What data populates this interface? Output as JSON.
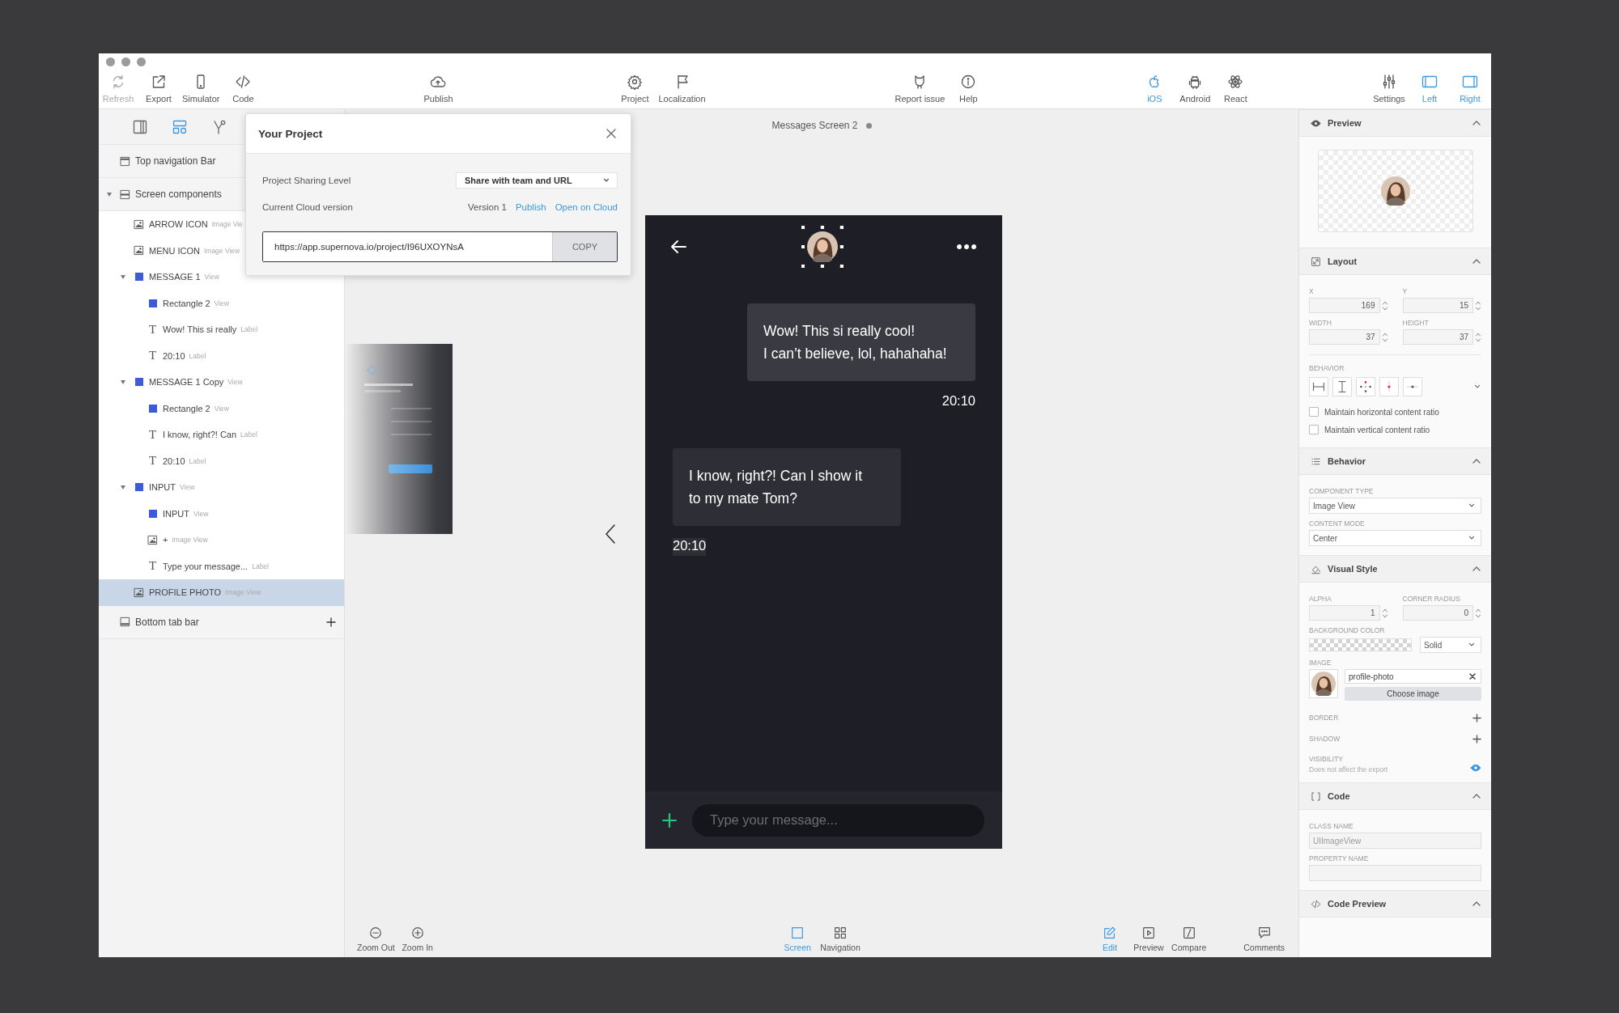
{
  "toolbar": {
    "groups": [
      [
        {
          "label": "Refresh",
          "disabled": true,
          "active": false
        },
        {
          "label": "Export",
          "disabled": false,
          "active": false
        },
        {
          "label": "Simulator",
          "disabled": false,
          "active": false
        },
        {
          "label": "Code",
          "disabled": false,
          "active": false
        }
      ],
      [
        {
          "label": "Publish",
          "disabled": false,
          "active": false
        }
      ],
      [
        {
          "label": "Project",
          "disabled": false,
          "active": false
        },
        {
          "label": "Localization",
          "disabled": false,
          "active": false
        }
      ],
      [
        {
          "label": "Report issue",
          "disabled": false,
          "active": false
        },
        {
          "label": "Help",
          "disabled": false,
          "active": false
        }
      ],
      [
        {
          "label": "iOS",
          "disabled": false,
          "active": true
        },
        {
          "label": "Android",
          "disabled": false,
          "active": false
        },
        {
          "label": "React",
          "disabled": false,
          "active": false
        }
      ],
      [
        {
          "label": "Settings",
          "disabled": false,
          "active": false
        },
        {
          "label": "Left",
          "disabled": false,
          "active": true
        },
        {
          "label": "Right",
          "disabled": false,
          "active": true
        }
      ]
    ]
  },
  "layers": {
    "tabs": [
      {
        "selected": false
      },
      {
        "selected": true
      },
      {
        "selected": false
      }
    ],
    "tree": [
      {
        "name": "Top navigation Bar",
        "kind": "top-bar",
        "selected": false
      },
      {
        "name": "Screen components",
        "kind": "screen",
        "selected": false,
        "expanded": true,
        "children": [
          {
            "name": "ARROW ICON",
            "type": "Image Vie",
            "kind": "image",
            "selected": false
          },
          {
            "name": "MENU ICON",
            "type": "Image View",
            "kind": "image",
            "selected": false
          },
          {
            "name": "MESSAGE 1",
            "type": "View",
            "kind": "view",
            "selected": false,
            "expanded": true,
            "children": [
              {
                "name": "Rectangle 2",
                "type": "View",
                "kind": "view",
                "selected": false
              },
              {
                "name": "Wow! This si really",
                "type": "Label",
                "kind": "text",
                "glyph": "T",
                "selected": false
              },
              {
                "name": "20:10",
                "type": "Label",
                "kind": "text",
                "glyph": "T",
                "selected": false
              }
            ]
          },
          {
            "name": "MESSAGE 1 Copy",
            "type": "View",
            "kind": "view",
            "selected": false,
            "expanded": true,
            "children": [
              {
                "name": "Rectangle 2",
                "type": "View",
                "kind": "view",
                "selected": false
              },
              {
                "name": "I know, right?! Can",
                "type": "Label",
                "kind": "text",
                "glyph": "T",
                "selected": false
              },
              {
                "name": "20:10",
                "type": "Label",
                "kind": "text",
                "glyph": "T",
                "selected": false
              }
            ]
          },
          {
            "name": "INPUT",
            "type": "View",
            "kind": "view",
            "selected": false,
            "expanded": true,
            "children": [
              {
                "name": "INPUT",
                "type": "View",
                "kind": "view",
                "selected": false
              },
              {
                "name": "+",
                "type": "Image View",
                "kind": "image",
                "selected": false
              },
              {
                "name": "Type your message...",
                "type": "Label",
                "kind": "text",
                "glyph": "T",
                "selected": false
              }
            ]
          },
          {
            "name": "PROFILE PHOTO",
            "type": "Image View",
            "kind": "image",
            "selected": true
          }
        ]
      },
      {
        "name": "Bottom tab bar",
        "kind": "bottom-bar",
        "selected": false
      }
    ]
  },
  "dialog": {
    "title": "Your Project",
    "rows": [
      {
        "label": "Project Sharing Level",
        "select": "Share with team and URL"
      },
      {
        "label": "Current Cloud version",
        "value": "Version 1",
        "links": [
          "Publish",
          "Open on Cloud"
        ]
      }
    ],
    "url": "https://app.supernova.io/project/I96UXOYNsA",
    "copy_button": "COPY"
  },
  "canvas": {
    "screen_title": "Messages Screen 2",
    "phone": {
      "messages": [
        {
          "outgoing": true,
          "text": "Wow! This si really cool!\nI can’t believe, lol, hahahaha!",
          "time": "20:10"
        },
        {
          "outgoing": false,
          "text": "I know, right?! Can I show it\nto my mate Tom?",
          "time": "20:10"
        }
      ],
      "input_placeholder": "Type your message..."
    },
    "bottom_bar": {
      "groups": [
        [
          {
            "label": "Zoom Out",
            "selected": false
          },
          {
            "label": "Zoom In",
            "selected": false
          }
        ],
        [
          {
            "label": "Screen",
            "selected": true
          },
          {
            "label": "Navigation",
            "selected": false
          }
        ],
        [
          {
            "label": "Edit",
            "selected": true
          },
          {
            "label": "Preview",
            "selected": false
          },
          {
            "label": "Compare",
            "selected": false
          },
          {
            "label": "Comments",
            "selected": false
          }
        ]
      ]
    }
  },
  "inspector": {
    "sections": [
      {
        "kind": "preview",
        "title": "Preview",
        "expanded": true
      },
      {
        "kind": "layout",
        "title": "Layout",
        "expanded": true,
        "fields": [
          {
            "label": "X",
            "value": "169"
          },
          {
            "label": "Y",
            "value": "15"
          },
          {
            "label": "WIDTH",
            "value": "37"
          },
          {
            "label": "HEIGHT",
            "value": "37"
          }
        ],
        "behavior_label": "BEHAVIOR",
        "options": [
          {
            "label": "Maintain horizontal content ratio",
            "checked": false
          },
          {
            "label": "Maintain vertical content ratio",
            "checked": false
          }
        ]
      },
      {
        "kind": "behavior",
        "title": "Behavior",
        "expanded": true,
        "selects": [
          {
            "label": "COMPONENT TYPE",
            "value": "Image View"
          },
          {
            "label": "CONTENT MODE",
            "value": "Center"
          }
        ]
      },
      {
        "kind": "visual",
        "title": "Visual Style",
        "expanded": true,
        "fields": [
          {
            "label": "ALPHA",
            "value": "1"
          },
          {
            "label": "CORNER RADIUS",
            "value": "0"
          }
        ],
        "background_label": "BACKGROUND COLOR",
        "fill_mode": "Solid",
        "image_label": "IMAGE",
        "image_name": "profile-photo",
        "choose_button": "Choose image",
        "adders": [
          {
            "label": "BORDER"
          },
          {
            "label": "SHADOW"
          }
        ],
        "visibility_label": "VISIBILITY",
        "visibility_hint": "Does not affect the export",
        "visible": true
      },
      {
        "kind": "code",
        "title": "Code",
        "expanded": true,
        "fields": [
          {
            "label": "CLASS NAME",
            "placeholder": "UIImageView"
          },
          {
            "label": "PROPERTY NAME"
          }
        ]
      },
      {
        "kind": "code_preview",
        "title": "Code Preview",
        "expanded": true
      }
    ]
  }
}
